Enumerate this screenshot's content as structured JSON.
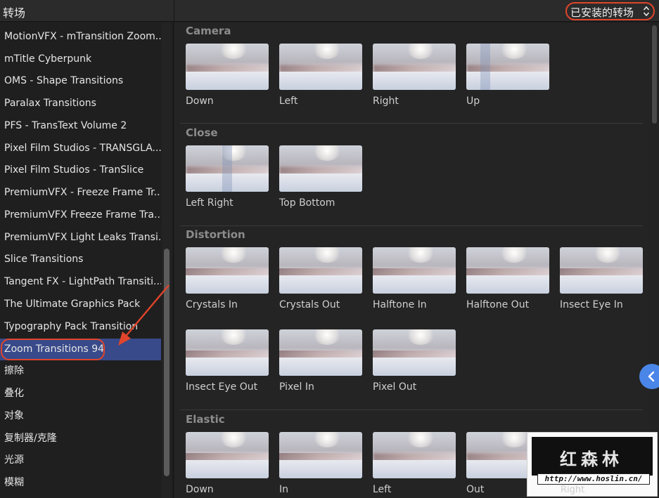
{
  "header": {
    "title": "转场",
    "filter_dropdown": "已安装的转场"
  },
  "sidebar": {
    "items": [
      {
        "label": "MotionVFX - mTransition Zoom..."
      },
      {
        "label": "mTitle Cyberpunk"
      },
      {
        "label": "OMS - Shape Transitions"
      },
      {
        "label": "Paralax Transitions"
      },
      {
        "label": "PFS - TransText Volume 2"
      },
      {
        "label": "Pixel Film Studios - TRANSGLA..."
      },
      {
        "label": "Pixel Film Studios - TranSlice"
      },
      {
        "label": "PremiumVFX - Freeze Frame Tr..."
      },
      {
        "label": "PremiumVFX Freeze Frame Tra..."
      },
      {
        "label": "PremiumVFX Light Leaks Transi..."
      },
      {
        "label": "Slice Transitions"
      },
      {
        "label": "Tangent FX - LightPath Transiti..."
      },
      {
        "label": "The Ultimate Graphics Pack"
      },
      {
        "label": "Typography Pack Transition"
      },
      {
        "label": "Zoom Transitions 94",
        "selected": true
      },
      {
        "label": "擦除"
      },
      {
        "label": "叠化"
      },
      {
        "label": "对象"
      },
      {
        "label": "复制器/克隆"
      },
      {
        "label": "光源"
      },
      {
        "label": "模糊"
      }
    ]
  },
  "sections": [
    {
      "title": "Camera",
      "items": [
        "Down",
        "Left",
        "Right",
        "Up"
      ]
    },
    {
      "title": "Close",
      "items": [
        "Left Right",
        "Top Bottom"
      ]
    },
    {
      "title": "Distortion",
      "items": [
        "Crystals In",
        "Crystals Out",
        "Halftone In",
        "Halftone Out",
        "Insect Eye In",
        "Insect Eye Out",
        "Pixel In",
        "Pixel Out"
      ]
    },
    {
      "title": "Elastic",
      "items": [
        "Down",
        "In",
        "Left",
        "Out",
        "Right"
      ]
    }
  ],
  "watermark": {
    "brand_cn": "红森林",
    "url": "http://www.hoslin.cn/"
  },
  "colors": {
    "selection": "#384a8a",
    "annotation": "#e0452b",
    "collapse_button": "#4a86e8"
  }
}
